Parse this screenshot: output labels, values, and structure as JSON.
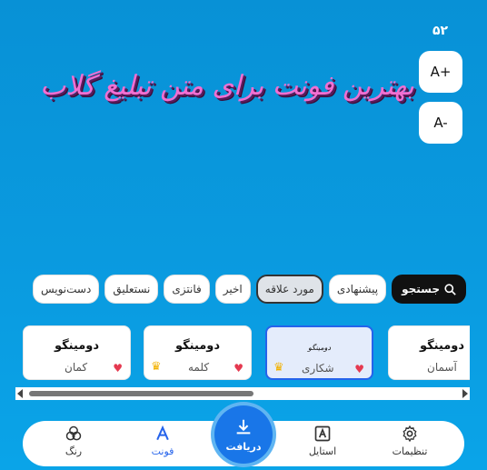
{
  "font_size": "۵۲",
  "size_buttons": {
    "increase": "A+",
    "decrease": "A-"
  },
  "preview_text": "بهترین فونت برای متن تبلیغ گلاب",
  "chips": [
    {
      "label": "جستجو"
    },
    {
      "label": "پیشنهادی"
    },
    {
      "label": "مورد علاقه"
    },
    {
      "label": "اخیر"
    },
    {
      "label": "فانتزی"
    },
    {
      "label": "نستعلیق"
    },
    {
      "label": "دست‌نویس"
    }
  ],
  "cards": [
    {
      "title": "دومینگو",
      "name": "آسمان"
    },
    {
      "title": "دومینگو",
      "name": "شکاری"
    },
    {
      "title": "دومینگو",
      "name": "کلمه"
    },
    {
      "title": "دومینگو",
      "name": "کمان"
    }
  ],
  "scroll_position": 0.5,
  "nav": {
    "settings": "تنظیمات",
    "style": "استایل",
    "download": "دریافت",
    "font": "فونت",
    "color": "رنگ"
  },
  "colors": {
    "accent": "#2563eb",
    "heart": "#e53950",
    "crown": "#f2b100",
    "background": "#0a9be0"
  }
}
